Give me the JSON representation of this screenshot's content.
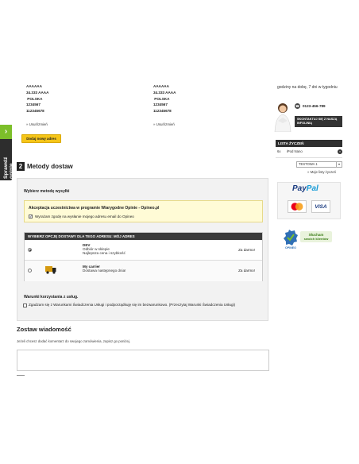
{
  "sidebar_tab": {
    "label": "Sprawdź opinie",
    "colors": {
      "accent": "#7cbf2a",
      "background": "#2d2d2d"
    }
  },
  "addresses": {
    "left": {
      "name": "AAAAAA",
      "city": "34.333 AAAA",
      "country": " POLSKA",
      "phone": "1234567",
      "nip": "112345678",
      "edit_link": "» Usuń/zmień"
    },
    "right": {
      "name": "AAAAAA",
      "city": "34.333 AAAA",
      "country": " POLSKA",
      "phone": "1234567",
      "nip": "112345678",
      "edit_link": "» Usuń/zmień"
    },
    "add_button": "Dodaj nowy adres"
  },
  "shipping": {
    "step_number": "2",
    "title": "Metody dostaw",
    "choose_label": "Wybierz metodę wysyłki",
    "acceptance": {
      "title": "Akceptacja uczestnictwa w programie Wiarygodne Opinie - Opineo.pl",
      "consent_text": "Wyrażam zgodę na wysłanie mojego adresu email do Opineo",
      "checked": true
    },
    "table": {
      "header": "WYBIERZ OPCJĘ DOSTAWY DLA TEGO ADRESU: MÓJ ADRES",
      "rows": [
        {
          "name": "DEV",
          "desc1": "Odbiór w sklepie",
          "desc2": "Najlepsza cena i szybkość",
          "price": "Za darmo!",
          "selected": true
        },
        {
          "name": "My carrier",
          "desc1": "Dostawa następnego dnia!",
          "desc2": "",
          "price": "Za darmo!",
          "selected": false
        }
      ]
    },
    "terms": {
      "title": "Warunki korzystania z usług.",
      "text": "Zgadzam się z Warunkami Świadczenia Usługi i podporządkuję się im bezwarunkowo. (Przeczytaj Warunki Świadczenia Usługi)"
    }
  },
  "message": {
    "title": "Zostaw wiadomość",
    "subtitle": "Jeżeli chcesz dodać komentarz do swojego zamówienia, zapisz go poniżej.",
    "value": ""
  },
  "right_column": {
    "hours": "godziny na dobę, 7 dni w tygodniu",
    "phone": "0123-456-789",
    "contact_button": "SKONTAKTUJ SIĘ Z NASZĄ INFOLINIĄ",
    "wishlist": {
      "title": "LISTA ŻYCZEŃ",
      "item_qty": "6x",
      "item_name": "iPod Nano",
      "remove": "×",
      "select_value": "TESTOWA 1",
      "link": "» Moje listy życzeń"
    },
    "payments": {
      "paypal": [
        "Pay",
        "Pal"
      ],
      "visa": "VISA"
    },
    "badge": {
      "line1": "Słucham",
      "line2": "swoich klientów",
      "brand": "OPINEO"
    }
  }
}
